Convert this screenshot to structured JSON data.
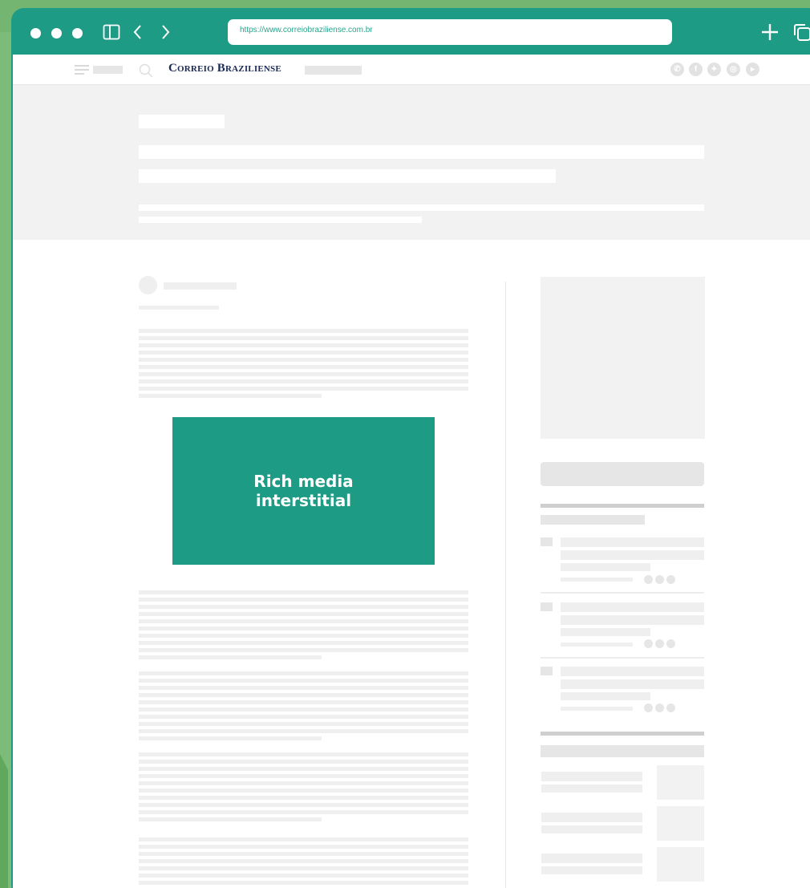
{
  "browser": {
    "url": "https://www.correiobraziliense.com.br"
  },
  "site": {
    "logo_text": "Correio Braziliense",
    "social_icons": [
      "whatsapp-icon",
      "facebook-icon",
      "twitter-icon",
      "instagram-icon",
      "youtube-icon"
    ]
  },
  "ad": {
    "label": "Rich media interstitial"
  },
  "colors": {
    "accent": "#1e9b85",
    "background": "#7dbb7b",
    "skeleton": "#efefef",
    "logo": "#1a2a57"
  }
}
